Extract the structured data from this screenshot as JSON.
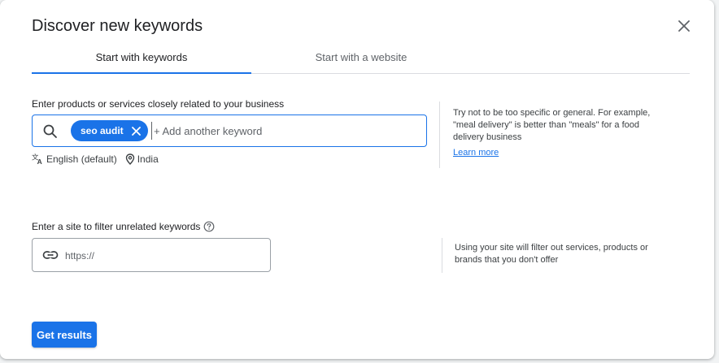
{
  "dialog": {
    "title": "Discover new keywords",
    "close_icon": "close-icon"
  },
  "tabs": [
    {
      "label": "Start with keywords",
      "active": true
    },
    {
      "label": "Start with a website",
      "active": false
    }
  ],
  "keywords": {
    "label": "Enter products or services closely related to your business",
    "chips": [
      "seo audit"
    ],
    "input_value": "",
    "placeholder": "+ Add another keyword",
    "language": "English (default)",
    "location": "India",
    "hint": "Try not to be too specific or general. For example, \"meal delivery\" is better than \"meals\" for a food delivery business",
    "learn_more": "Learn more"
  },
  "site": {
    "label": "Enter a site to filter unrelated keywords",
    "input_value": "",
    "placeholder": "https://",
    "hint": "Using your site will filter out services, products or brands that you don't offer"
  },
  "actions": {
    "get_results": "Get results"
  },
  "colors": {
    "accent": "#1a73e8",
    "text": "#202124",
    "muted": "#5f6368",
    "divider": "#dadce0"
  }
}
